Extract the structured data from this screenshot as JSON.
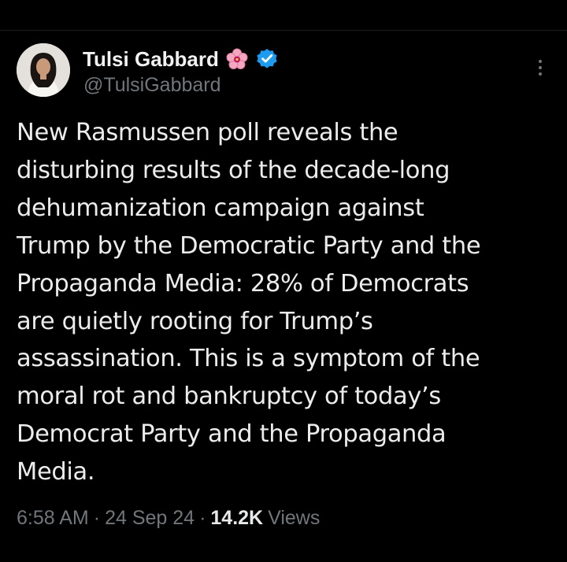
{
  "post": {
    "author": {
      "display_name": "Tulsi Gabbard",
      "handle": "@TulsiGabbard",
      "name_emoji_icon": "hibiscus-flower-icon",
      "verified_icon": "verified-badge-icon",
      "avatar_icon": "profile-photo-avatar"
    },
    "more_icon": "more-options-icon",
    "text": "New Rasmussen poll reveals the\ndisturbing results of the decade-long\ndehumanization campaign against\nTrump by the Democratic Party and the\nPropaganda Media: 28% of Democrats\nare quietly rooting for Trump’s\nassassination. This is a symptom of the\nmoral rot and bankruptcy of today’s\nDemocrat Party and the Propaganda\nMedia.",
    "time": "6:58 AM",
    "separator": "·",
    "date": "24 Sep 24",
    "views_count": "14.2K",
    "views_label": "Views"
  },
  "colors": {
    "background": "#000000",
    "text_primary": "#e7e9ea",
    "text_secondary": "#71767b",
    "verified_blue": "#1d9bf0",
    "flower_pink": "#f4a7c0"
  }
}
